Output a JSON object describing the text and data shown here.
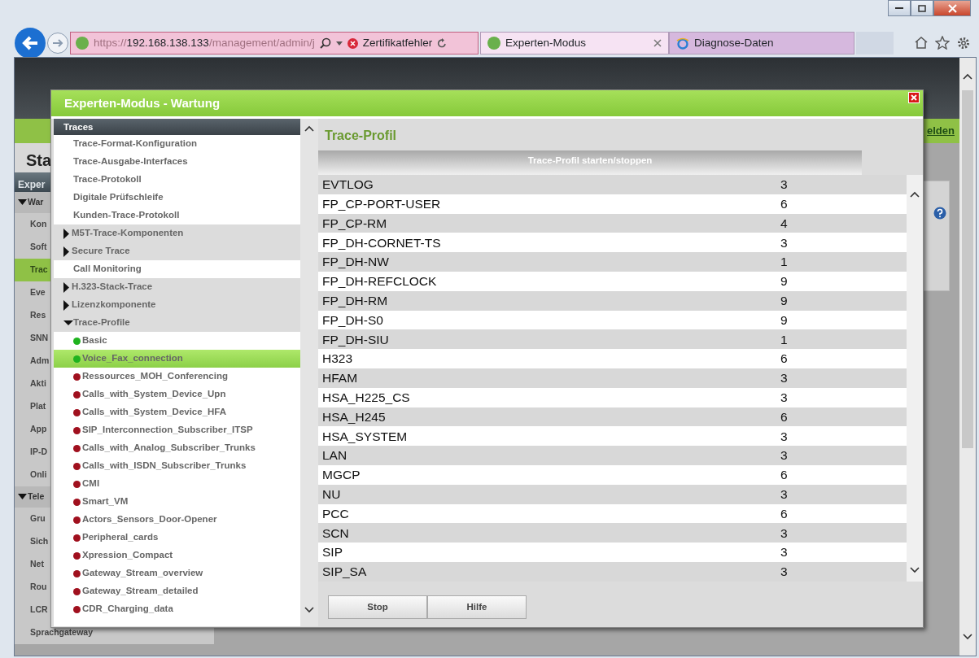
{
  "browser": {
    "address": {
      "scheme": "https://",
      "host": "192.168.138.133",
      "path": "/management/admin/j"
    },
    "cert_error": "Zertifikatfehler",
    "tabs": [
      {
        "label": "Experten-Modus",
        "selected": true
      },
      {
        "label": "Diagnose-Daten",
        "selected": false
      }
    ]
  },
  "background": {
    "heading": "Sta",
    "link": "elden",
    "panel_title": "Exper",
    "menu": [
      {
        "label": "War",
        "kind": "group",
        "selected": false
      },
      {
        "label": "Kon",
        "kind": "item",
        "selected": false
      },
      {
        "label": "Soft",
        "kind": "item",
        "selected": false
      },
      {
        "label": "Trac",
        "kind": "item",
        "selected": true
      },
      {
        "label": "Eve",
        "kind": "item",
        "selected": false
      },
      {
        "label": "Res",
        "kind": "item",
        "selected": false
      },
      {
        "label": "SNN",
        "kind": "item",
        "selected": false
      },
      {
        "label": "Adm",
        "kind": "item",
        "selected": false
      },
      {
        "label": "Akti",
        "kind": "item",
        "selected": false
      },
      {
        "label": "Plat",
        "kind": "item",
        "selected": false
      },
      {
        "label": "App",
        "kind": "item",
        "selected": false
      },
      {
        "label": "IP-D",
        "kind": "item",
        "selected": false
      },
      {
        "label": "Onli",
        "kind": "item",
        "selected": false
      },
      {
        "label": "Tele",
        "kind": "group",
        "selected": false
      },
      {
        "label": "Gru",
        "kind": "item",
        "selected": false
      },
      {
        "label": "Sich",
        "kind": "item",
        "selected": false
      },
      {
        "label": "Net",
        "kind": "item",
        "selected": false
      },
      {
        "label": "Rou",
        "kind": "item",
        "selected": false
      },
      {
        "label": "LCR",
        "kind": "item",
        "selected": false
      },
      {
        "label": "Sprachgateway",
        "kind": "item",
        "selected": false
      }
    ]
  },
  "modal": {
    "title": "Experten-Modus - Wartung",
    "tree": {
      "header": "Traces",
      "items": [
        {
          "label": "Trace-Format-Konfiguration",
          "kind": "link"
        },
        {
          "label": "Trace-Ausgabe-Interfaces",
          "kind": "link"
        },
        {
          "label": "Trace-Protokoll",
          "kind": "link"
        },
        {
          "label": "Digitale Prüfschleife",
          "kind": "link"
        },
        {
          "label": "Kunden-Trace-Protokoll",
          "kind": "link"
        },
        {
          "label": "M5T-Trace-Komponenten",
          "kind": "folder",
          "expanded": false
        },
        {
          "label": "Secure Trace",
          "kind": "folder",
          "expanded": false
        },
        {
          "label": "Call Monitoring",
          "kind": "link"
        },
        {
          "label": "H.323-Stack-Trace",
          "kind": "folder",
          "expanded": false
        },
        {
          "label": "Lizenzkomponente",
          "kind": "folder",
          "expanded": false
        },
        {
          "label": "Trace-Profile",
          "kind": "folder",
          "expanded": true,
          "children": [
            {
              "label": "Basic",
              "kind": "profile",
              "color": "#1fb31f",
              "selected": false
            },
            {
              "label": "Voice_Fax_connection",
              "kind": "profile",
              "color": "#1fb31f",
              "selected": true
            },
            {
              "label": "Ressources_MOH_Conferencing",
              "kind": "profile",
              "color": "#a0101e",
              "selected": false
            },
            {
              "label": "Calls_with_System_Device_Upn",
              "kind": "profile",
              "color": "#a0101e",
              "selected": false
            },
            {
              "label": "Calls_with_System_Device_HFA",
              "kind": "profile",
              "color": "#a0101e",
              "selected": false
            },
            {
              "label": "SIP_Interconnection_Subscriber_ITSP",
              "kind": "profile",
              "color": "#a0101e",
              "selected": false
            },
            {
              "label": "Calls_with_Analog_Subscriber_Trunks",
              "kind": "profile",
              "color": "#a0101e",
              "selected": false
            },
            {
              "label": "Calls_with_ISDN_Subscriber_Trunks",
              "kind": "profile",
              "color": "#a0101e",
              "selected": false
            },
            {
              "label": "CMI",
              "kind": "profile",
              "color": "#a0101e",
              "selected": false
            },
            {
              "label": "Smart_VM",
              "kind": "profile",
              "color": "#a0101e",
              "selected": false
            },
            {
              "label": "Actors_Sensors_Door-Opener",
              "kind": "profile",
              "color": "#a0101e",
              "selected": false
            },
            {
              "label": "Peripheral_cards",
              "kind": "profile",
              "color": "#a0101e",
              "selected": false
            },
            {
              "label": "Xpression_Compact",
              "kind": "profile",
              "color": "#a0101e",
              "selected": false
            },
            {
              "label": "Gateway_Stream_overview",
              "kind": "profile",
              "color": "#a0101e",
              "selected": false
            },
            {
              "label": "Gateway_Stream_detailed",
              "kind": "profile",
              "color": "#a0101e",
              "selected": false
            },
            {
              "label": "CDR_Charging_data",
              "kind": "profile",
              "color": "#a0101e",
              "selected": false
            }
          ]
        }
      ]
    },
    "content": {
      "title": "Trace-Profil",
      "column_header": "Trace-Profil starten/stoppen",
      "rows": [
        {
          "name": "EVTLOG",
          "value": "3"
        },
        {
          "name": "FP_CP-PORT-USER",
          "value": "6"
        },
        {
          "name": "FP_CP-RM",
          "value": "4"
        },
        {
          "name": "FP_DH-CORNET-TS",
          "value": "3"
        },
        {
          "name": "FP_DH-NW",
          "value": "1"
        },
        {
          "name": "FP_DH-REFCLOCK",
          "value": "9"
        },
        {
          "name": "FP_DH-RM",
          "value": "9"
        },
        {
          "name": "FP_DH-S0",
          "value": "9"
        },
        {
          "name": "FP_DH-SIU",
          "value": "1"
        },
        {
          "name": "H323",
          "value": "6"
        },
        {
          "name": "HFAM",
          "value": "3"
        },
        {
          "name": "HSA_H225_CS",
          "value": "3"
        },
        {
          "name": "HSA_H245",
          "value": "6"
        },
        {
          "name": "HSA_SYSTEM",
          "value": "3"
        },
        {
          "name": "LAN",
          "value": "3"
        },
        {
          "name": "MGCP",
          "value": "6"
        },
        {
          "name": "NU",
          "value": "3"
        },
        {
          "name": "PCC",
          "value": "6"
        },
        {
          "name": "SCN",
          "value": "3"
        },
        {
          "name": "SIP",
          "value": "3"
        },
        {
          "name": "SIP_SA",
          "value": "3"
        }
      ],
      "buttons": [
        "Stop",
        "Hilfe"
      ]
    }
  }
}
